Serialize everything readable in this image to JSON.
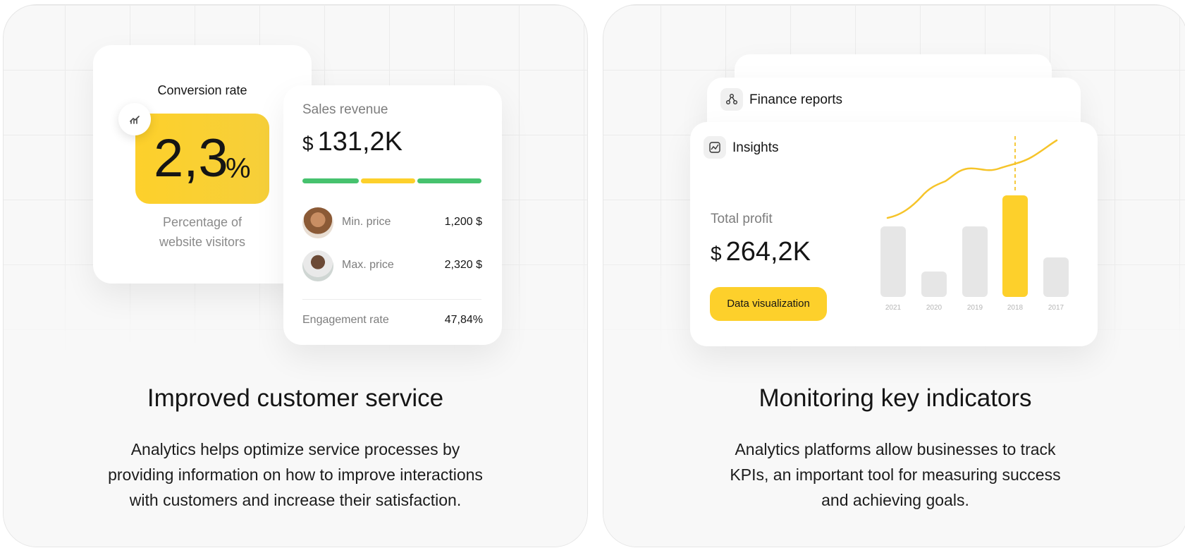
{
  "left": {
    "conversion": {
      "label": "Conversion rate",
      "value": "2,3",
      "unit": "%",
      "caption_1": "Percentage of",
      "caption_2": "website visitors"
    },
    "sales": {
      "label": "Sales revenue",
      "currency": "$",
      "amount": "131,2K",
      "min_label": "Min. price",
      "min_value": "1,200 $",
      "max_label": "Max. price",
      "max_value": "2,320 $",
      "engagement_label": "Engagement rate",
      "engagement_value": "47,84%"
    },
    "title": "Improved customer service",
    "desc_1": "Analytics helps optimize service processes by",
    "desc_2": "providing information on how to improve interactions",
    "desc_3": "with customers and increase their satisfaction."
  },
  "right": {
    "finance_label": "Finance reports",
    "insights_label": "Insights",
    "profit_label": "Total profit",
    "currency": "$",
    "profit_value": "264,2K",
    "button_label": "Data visualization",
    "years": [
      "2021",
      "2020",
      "2019",
      "2018",
      "2017"
    ],
    "title": "Monitoring key indicators",
    "desc_1": "Analytics platforms allow businesses to track",
    "desc_2": "KPIs, an important tool for measuring success",
    "desc_3": "and achieving goals."
  },
  "colors": {
    "accent": "#fdd02b",
    "green": "#46c26e",
    "bar_grey": "#e6e6e6"
  },
  "icons": [
    "chart-icon",
    "share-nodes-icon",
    "insights-icon"
  ]
}
